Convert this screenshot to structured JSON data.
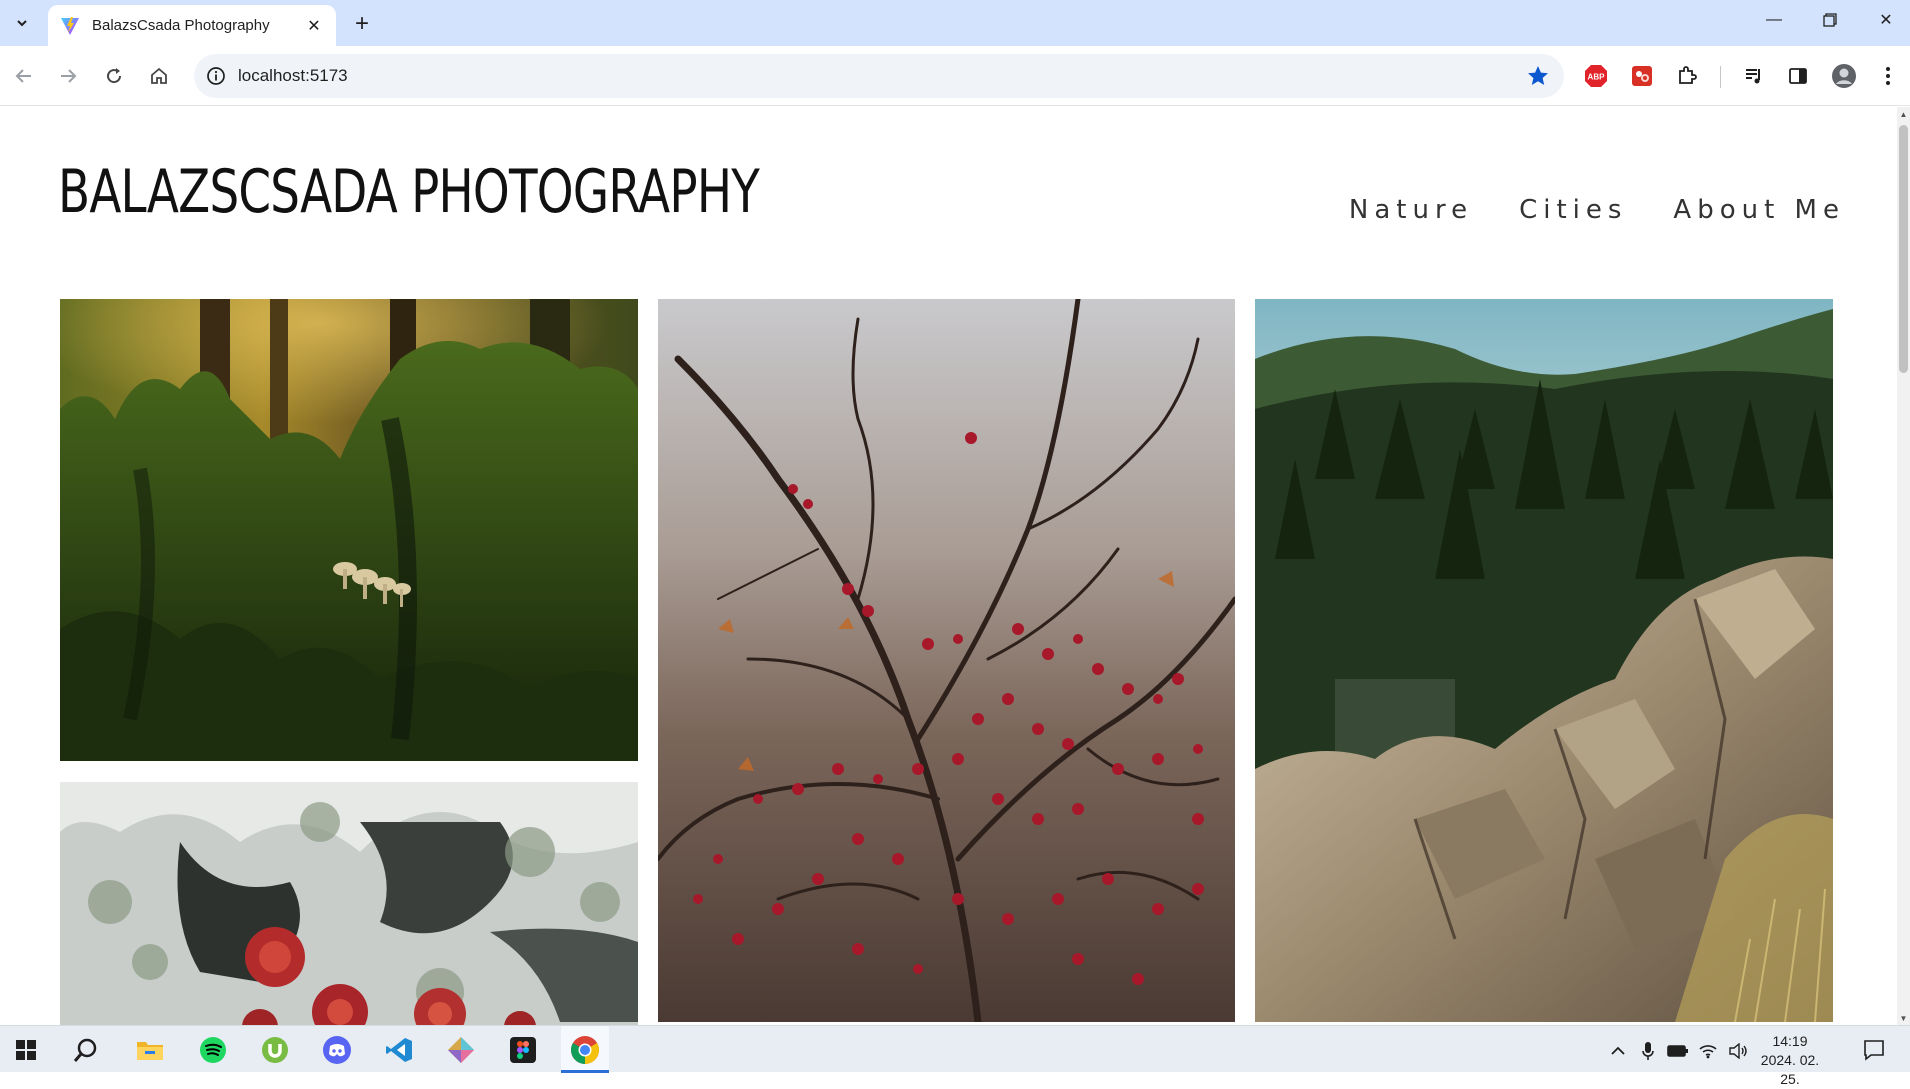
{
  "browser": {
    "tab_title": "BalazsCsada Photography",
    "url": "localhost:5173"
  },
  "page": {
    "site_title": "BALAZSCSADA PHOTOGRAPHY",
    "nav": [
      "Nature",
      "Cities",
      "About Me"
    ],
    "photos": [
      {
        "subject": "mossy tree stump with mushrooms in forest"
      },
      {
        "subject": "hawthorn branches with red berries and raindrops"
      },
      {
        "subject": "pine forest valley with limestone rocks"
      },
      {
        "subject": "lichen covered rock with red succulents"
      }
    ]
  },
  "taskbar": {
    "time": "14:19",
    "date": "2024. 02. 25."
  },
  "colors": {
    "tabbar": "#d3e3fd",
    "accent_blue": "#0b57d0",
    "taskbar": "#e8edf4"
  }
}
